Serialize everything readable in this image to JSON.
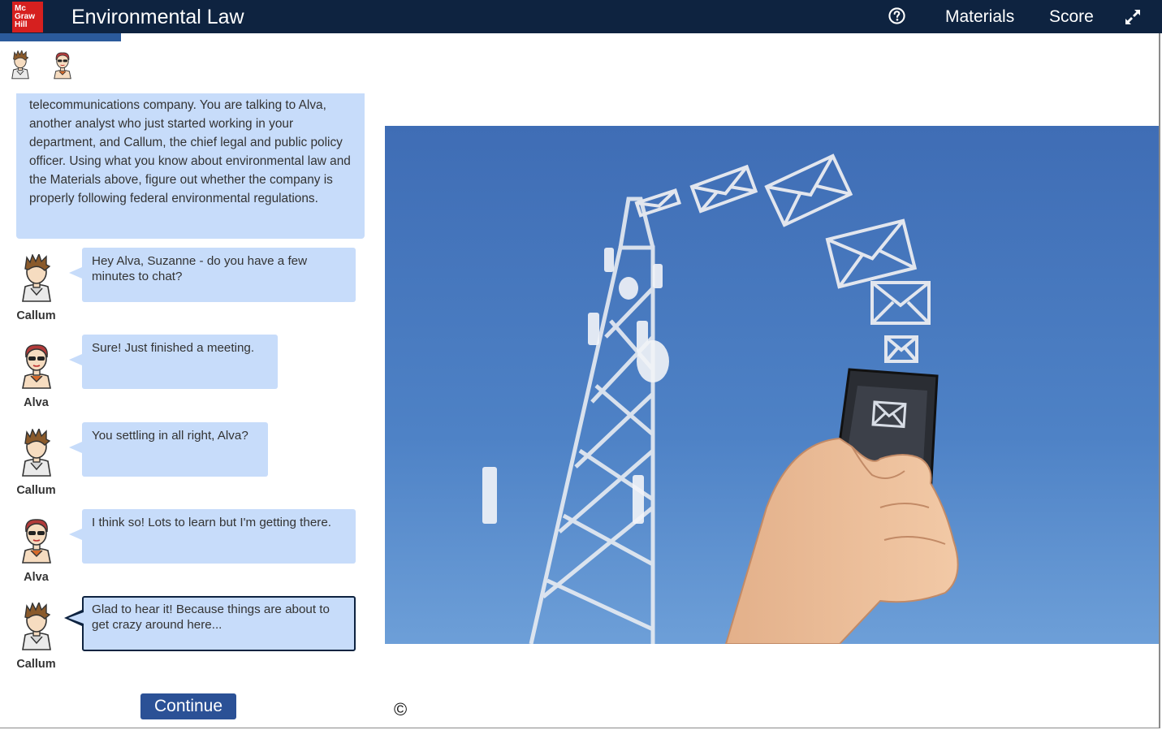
{
  "header": {
    "logo_lines": [
      "Mc",
      "Graw",
      "Hill"
    ],
    "title": "Environmental Law",
    "help_icon": "question-circle-icon",
    "materials_label": "Materials",
    "score_label": "Score",
    "expand_icon": "expand-arrows-icon",
    "bar_color": "#0e2340",
    "logo_color": "#d6201f"
  },
  "participants": [
    {
      "name": "Callum",
      "icon": "male-avatar-icon"
    },
    {
      "name": "Alva",
      "icon": "female-avatar-sunglasses-icon"
    }
  ],
  "intro_text": "telecommunications company. You are talking to Alva, another analyst who just started working in your department, and Callum, the chief legal and public policy officer. Using what you know about environmental law and the Materials above, figure out whether the company is properly following federal environmental regulations.",
  "messages": [
    {
      "speaker": "Callum",
      "text": "Hey Alva, Suzanne - do you have a few minutes to chat?"
    },
    {
      "speaker": "Alva",
      "text": "Sure! Just finished a meeting."
    },
    {
      "speaker": "Callum",
      "text": "You settling in all right, Alva?"
    },
    {
      "speaker": "Alva",
      "text": "I think so! Lots to learn but I'm getting there."
    },
    {
      "speaker": "Callum",
      "text": "Glad to hear it! Because things are about to get crazy around here..."
    }
  ],
  "continue_label": "Continue",
  "copyright_symbol": "©",
  "scene_image": "cell-tower-phone-messages-photo",
  "colors": {
    "bubble": "#c7dcfa",
    "button": "#2b5196",
    "progress": "#2b5a9b"
  }
}
